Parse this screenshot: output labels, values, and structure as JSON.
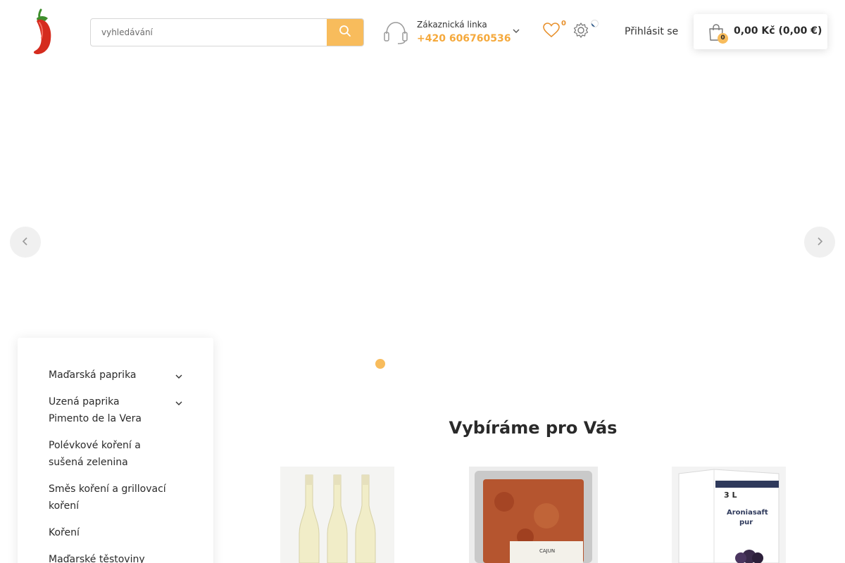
{
  "header": {
    "logo_icon": "chili-pepper-logo",
    "search": {
      "placeholder": "vyhledávání",
      "value": "",
      "button_icon": "search-icon"
    },
    "hotline": {
      "label": "Zákaznická linka",
      "phone": "+420 606760536"
    },
    "wishlist": {
      "count": "0"
    },
    "language_flag": "cz-flag",
    "login_label": "Přihlásit se",
    "cart": {
      "count": "0",
      "total": "0,00 Kč (0,00 €)"
    }
  },
  "sidebar": {
    "categories": [
      {
        "label": "Maďarská paprika",
        "has_children": true
      },
      {
        "label": "Uzená paprika Pimento de la Vera",
        "has_children": true
      },
      {
        "label": "Polévkové koření a sušená zelenina",
        "has_children": false
      },
      {
        "label": "Směs koření a grillovací koření",
        "has_children": false
      },
      {
        "label": "Koření",
        "has_children": false
      },
      {
        "label": "Maďarské těstoviny",
        "has_children": false
      }
    ]
  },
  "main": {
    "section_title": "Vybíráme pro Vás",
    "products": [
      {
        "image": "white-wine-bottles"
      },
      {
        "image": "spice-pack-cajun",
        "pack_label": "CAJUN"
      },
      {
        "image": "aroniasaft-box",
        "volume": "3 L",
        "brand": "Aroniasaft",
        "subtitle": "pur"
      }
    ]
  },
  "colors": {
    "accent": "#f8bc5c",
    "phone": "#f5a93c",
    "text": "#2a2a2a"
  }
}
